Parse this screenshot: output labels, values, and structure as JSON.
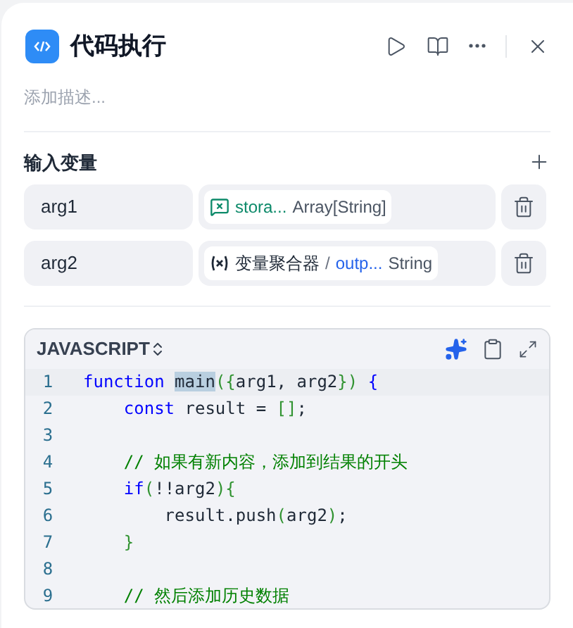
{
  "header": {
    "title": "代码执行",
    "description_placeholder": "添加描述..."
  },
  "inputs": {
    "title": "输入变量",
    "variables": [
      {
        "name": "arg1",
        "source": {
          "kind": "conversation",
          "field": "stora...",
          "type": "Array[String]"
        }
      },
      {
        "name": "arg2",
        "source": {
          "kind": "variable",
          "node": "变量聚合器",
          "separator": "/",
          "field": "outp...",
          "type": "String"
        }
      }
    ]
  },
  "editor": {
    "language": "JAVASCRIPT",
    "lines": [
      {
        "number": "1",
        "tokens": [
          {
            "kind": "keyword",
            "text": "function "
          },
          {
            "kind": "match",
            "text": "main"
          },
          {
            "kind": "bracket",
            "text": "({"
          },
          {
            "kind": "plain",
            "text": "arg1, arg2"
          },
          {
            "kind": "bracket",
            "text": "})"
          },
          {
            "kind": "keyword",
            "text": " {"
          }
        ]
      },
      {
        "number": "2",
        "tokens": [
          {
            "kind": "keyword",
            "text": "    const"
          },
          {
            "kind": "plain",
            "text": " result = "
          },
          {
            "kind": "bracket",
            "text": "[]"
          },
          {
            "kind": "plain",
            "text": ";"
          }
        ]
      },
      {
        "number": "3"
      },
      {
        "number": "4",
        "tokens": [
          {
            "kind": "comment",
            "text": "    // 如果有新内容，添加到结果的开头"
          }
        ]
      },
      {
        "number": "5",
        "tokens": [
          {
            "kind": "keyword",
            "text": "    if"
          },
          {
            "kind": "bracket",
            "text": "("
          },
          {
            "kind": "plain",
            "text": "!!arg2"
          },
          {
            "kind": "bracket",
            "text": "){"
          }
        ]
      },
      {
        "number": "6",
        "tokens": [
          {
            "kind": "plain",
            "text": "        result.push"
          },
          {
            "kind": "bracket",
            "text": "("
          },
          {
            "kind": "plain",
            "text": "arg2"
          },
          {
            "kind": "bracket",
            "text": ")"
          },
          {
            "kind": "plain",
            "text": ";"
          }
        ]
      },
      {
        "number": "7",
        "tokens": [
          {
            "kind": "bracket",
            "text": "    }"
          }
        ]
      },
      {
        "number": "8"
      },
      {
        "number": "9",
        "tokens": [
          {
            "kind": "comment",
            "text": "    // 然后添加历史数据"
          }
        ]
      }
    ]
  }
}
